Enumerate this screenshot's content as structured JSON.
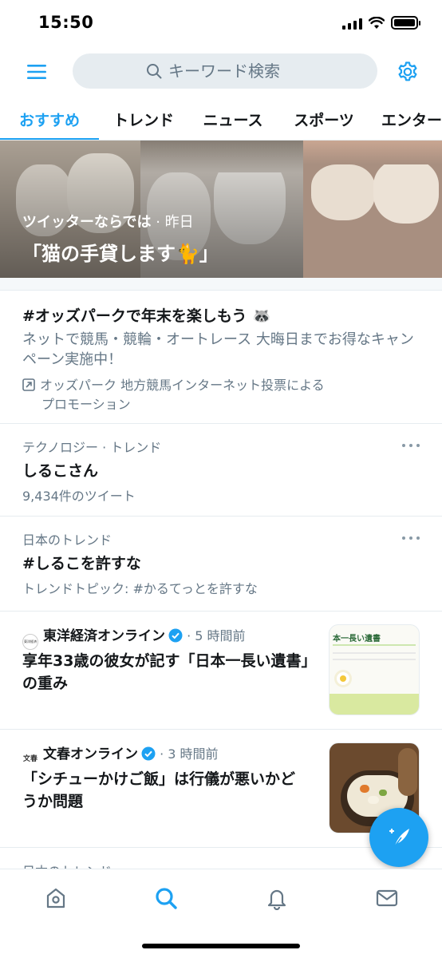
{
  "status_bar": {
    "time": "15:50"
  },
  "header": {
    "search_placeholder": "キーワード検索"
  },
  "tabs": [
    {
      "label": "おすすめ",
      "active": true
    },
    {
      "label": "トレンド",
      "active": false
    },
    {
      "label": "ニュース",
      "active": false
    },
    {
      "label": "スポーツ",
      "active": false
    },
    {
      "label": "エンター",
      "active": false
    }
  ],
  "hero": {
    "source": "ツイッターならでは",
    "time": " · 昨日",
    "title": "「猫の手貸します🐈」"
  },
  "promoted": {
    "title": "#オッズパークで年末を楽しもう 🦝",
    "description": "ネットで競馬・競輪・オートレース 大晦日までお得なキャンペーン実施中！",
    "promoter_line1": "オッズパーク 地方競馬インターネット投票による",
    "promoter_line2": "プロモーション"
  },
  "trends": [
    {
      "category": "テクノロジー · トレンド",
      "name": "しるこさん",
      "detail": "9,434件のツイート"
    },
    {
      "category": "日本のトレンド",
      "name": "#しるこを許すな",
      "detail": "トレンドトピック: #かるてっとを許すな"
    }
  ],
  "news": [
    {
      "source": "東洋経済オンライン",
      "time": "· 5 時間前",
      "title_line1": "享年33歳の彼女が記す「日本一長い遺書」",
      "title_line2": "の重み",
      "thumb_text": "本一長い遺書",
      "logo_text": "東洋経済"
    },
    {
      "source": "文春オンライン",
      "time": "· 3 時間前",
      "title_line1": "「シチューかけご飯」は行儀が悪いかど",
      "title_line2": "うか問題",
      "logo_text": "文春"
    }
  ],
  "partial_item": {
    "category": "日本のトレンド"
  },
  "colors": {
    "accent": "#1da1f2",
    "secondary_text": "#657786",
    "divider": "#e6ecf0"
  },
  "icons": [
    "menu-icon",
    "search-icon",
    "gear-icon",
    "promoted-arrow-icon",
    "verified-icon",
    "compose-icon",
    "home-icon",
    "explore-icon",
    "bell-icon",
    "mail-icon"
  ]
}
